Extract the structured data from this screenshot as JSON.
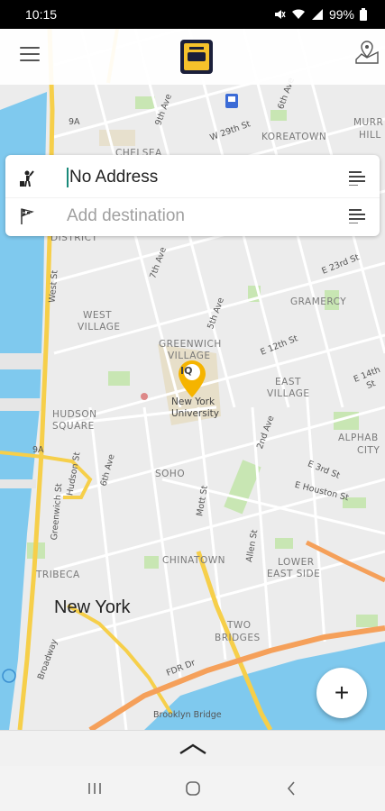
{
  "status_bar": {
    "time": "10:15",
    "battery": "99%"
  },
  "icons": {
    "menu": "hamburger-menu-icon",
    "logo": "taxi-app-logo",
    "map_pin_button": "map-pin-icon",
    "pickup": "person-waving-icon",
    "destination": "checkered-flag-icon",
    "list": "list-lines-icon",
    "add": "plus-icon",
    "expand": "chevron-up-icon"
  },
  "address_card": {
    "pickup_value": "No Address",
    "destination_placeholder": "Add destination"
  },
  "fab": {
    "label": "+"
  },
  "map": {
    "city_label": "New York",
    "poi_label_line1": "New York",
    "poi_label_line2": "University",
    "poi_badge": "IQ",
    "neighborhoods": {
      "chelsea": "CHELSEA",
      "koreatown": "KOREATOWN",
      "murray_hill_1": "MURR",
      "murray_hill_2": "HILL",
      "west_village_1": "WEST",
      "west_village_2": "VILLAGE",
      "greenwich_1": "GREENWICH",
      "greenwich_2": "VILLAGE",
      "gramercy": "GRAMERCY",
      "east_village_1": "EAST",
      "east_village_2": "VILLAGE",
      "hudson_square_1": "HUDSON",
      "hudson_square_2": "SQUARE",
      "soho": "SOHO",
      "alphabet_1": "ALPHAB",
      "alphabet_2": "CITY",
      "tribeca": "TRIBECA",
      "chinatown": "CHINATOWN",
      "lower_east_1": "LOWER",
      "lower_east_2": "EAST SIDE",
      "two_bridges_1": "TWO",
      "two_bridges_2": "BRIDGES",
      "district": "DISTRICT"
    },
    "streets": {
      "ninth_ave": "9th Ave",
      "w_29th": "W 29th St",
      "sixth_ave": "6th Ave",
      "fifth_ave": "5th Ave",
      "seventh_ave": "7th Ave",
      "fifth_ave_b": "5th Ave",
      "e_23rd": "E 23rd St",
      "west_st": "West St",
      "e_12th": "E 12th St",
      "e_14th": "E 14th St",
      "second_ave": "2nd Ave",
      "sixth_ave_b": "6th Ave",
      "hudson_st": "Hudson St",
      "greenwich_st": "Greenwich St",
      "mott_st": "Mott St",
      "e_3rd": "E 3rd St",
      "e_houston": "E Houston St",
      "allen_st": "Allen St",
      "broadway": "Broadway",
      "fdr_dr": "FDR Dr",
      "brooklyn_bridge": "Brooklyn Bridge",
      "route_9a_1": "9A",
      "route_9a_2": "9A",
      "w_st": "W"
    }
  }
}
